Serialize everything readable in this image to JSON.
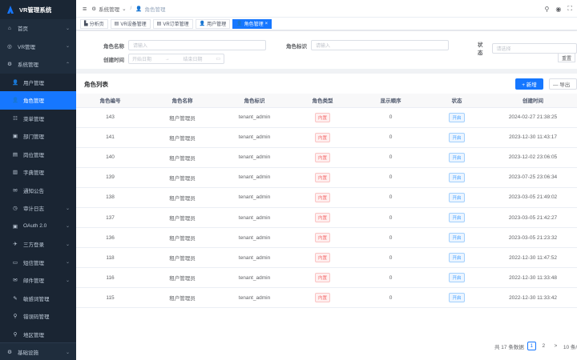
{
  "app": {
    "title": "VR管理系统"
  },
  "sidebar": {
    "items": [
      {
        "icon": "⌂",
        "label": "首页",
        "arrow": "⌄",
        "level": 0,
        "active": false
      },
      {
        "icon": "◎",
        "label": "VR管理",
        "arrow": "⌄",
        "level": 0,
        "active": false
      },
      {
        "icon": "⚙",
        "label": "系统管理",
        "arrow": "⌃",
        "level": 0,
        "active": false
      },
      {
        "icon": "👤",
        "label": "用户管理",
        "arrow": "",
        "level": 1,
        "active": false
      },
      {
        "icon": "👤",
        "label": "角色管理",
        "arrow": "",
        "level": 1,
        "active": true
      },
      {
        "icon": "☷",
        "label": "菜单管理",
        "arrow": "",
        "level": 1,
        "active": false
      },
      {
        "icon": "▣",
        "label": "部门管理",
        "arrow": "",
        "level": 1,
        "active": false
      },
      {
        "icon": "▤",
        "label": "岗位管理",
        "arrow": "",
        "level": 1,
        "active": false
      },
      {
        "icon": "▥",
        "label": "字典管理",
        "arrow": "",
        "level": 1,
        "active": false
      },
      {
        "icon": "✉",
        "label": "通知公告",
        "arrow": "",
        "level": 1,
        "active": false
      },
      {
        "icon": "◷",
        "label": "审计日志",
        "arrow": "⌄",
        "level": 1,
        "active": false
      },
      {
        "icon": "▣",
        "label": "OAuth 2.0",
        "arrow": "⌄",
        "level": 1,
        "active": false
      },
      {
        "icon": "✈",
        "label": "三方登录",
        "arrow": "⌄",
        "level": 1,
        "active": false
      },
      {
        "icon": "▭",
        "label": "短信管理",
        "arrow": "⌄",
        "level": 1,
        "active": false
      },
      {
        "icon": "✉",
        "label": "邮件管理",
        "arrow": "⌄",
        "level": 1,
        "active": false
      },
      {
        "icon": "✎",
        "label": "敏感词管理",
        "arrow": "",
        "level": 1,
        "active": false
      },
      {
        "icon": "⚲",
        "label": "错误码管理",
        "arrow": "",
        "level": 1,
        "active": false
      },
      {
        "icon": "⚲",
        "label": "地区管理",
        "arrow": "",
        "level": 1,
        "active": false
      }
    ],
    "bottom": {
      "icon": "⚙",
      "label": "基础设施",
      "arrow": "⌄"
    }
  },
  "topbar": {
    "breadcrumb": [
      "系统管理",
      "角色管理"
    ],
    "icons": [
      "search-icon",
      "github-icon",
      "fullscreen-icon"
    ]
  },
  "tabs": [
    {
      "icon": "▙",
      "label": "分析页",
      "active": false
    },
    {
      "icon": "▤",
      "label": "VR设备管理",
      "active": false
    },
    {
      "icon": "▤",
      "label": "VR订单管理",
      "active": false
    },
    {
      "icon": "👤",
      "label": "用户管理",
      "active": false
    },
    {
      "icon": "👤",
      "label": "角色管理",
      "active": true
    }
  ],
  "search": {
    "role_name_label": "角色名称",
    "role_name_placeholder": "请输入",
    "role_key_label": "角色标识",
    "role_key_placeholder": "请输入",
    "status_label": "状态",
    "status_placeholder": "请选择",
    "created_label": "创建时间",
    "start_placeholder": "开始日期",
    "range_sep": "→",
    "end_placeholder": "结束日期",
    "reset_label": "重置"
  },
  "table": {
    "title": "角色列表",
    "add_label": "+ 新增",
    "export_label": "— 导出",
    "columns": [
      "角色编号",
      "角色名称",
      "角色标识",
      "角色类型",
      "显示顺序",
      "状态",
      "创建时间"
    ],
    "rows": [
      [
        "143",
        "租户管理员",
        "tenant_admin",
        "内置",
        "0",
        "开启",
        "2024-02-27 21:38:25"
      ],
      [
        "141",
        "租户管理员",
        "tenant_admin",
        "内置",
        "0",
        "开启",
        "2023-12-30 11:43:17"
      ],
      [
        "140",
        "租户管理员",
        "tenant_admin",
        "内置",
        "0",
        "开启",
        "2023-12-02 23:06:05"
      ],
      [
        "139",
        "租户管理员",
        "tenant_admin",
        "内置",
        "0",
        "开启",
        "2023-07-25 23:06:34"
      ],
      [
        "138",
        "租户管理员",
        "tenant_admin",
        "内置",
        "0",
        "开启",
        "2023-03-05 21:49:02"
      ],
      [
        "137",
        "租户管理员",
        "tenant_admin",
        "内置",
        "0",
        "开启",
        "2023-03-05 21:42:27"
      ],
      [
        "136",
        "租户管理员",
        "tenant_admin",
        "内置",
        "0",
        "开启",
        "2023-03-05 21:23:32"
      ],
      [
        "118",
        "租户管理员",
        "tenant_admin",
        "内置",
        "0",
        "开启",
        "2022-12-30 11:47:52"
      ],
      [
        "116",
        "租户管理员",
        "tenant_admin",
        "内置",
        "0",
        "开启",
        "2022-12-30 11:33:48"
      ],
      [
        "115",
        "租户管理员",
        "tenant_admin",
        "内置",
        "0",
        "开启",
        "2022-12-30 11:33:42"
      ]
    ]
  },
  "pagination": {
    "total": "共 17 条数据",
    "pages": [
      "1",
      "2"
    ],
    "next": ">",
    "page_size": "10 条/"
  },
  "colors": {
    "accent": "#1677ff",
    "sidebar": "#1f2d3d",
    "danger": "#f56c6c"
  }
}
